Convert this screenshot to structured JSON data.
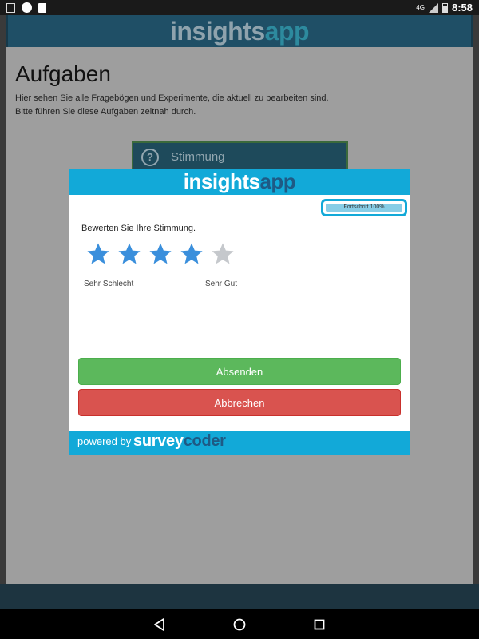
{
  "statusbar": {
    "time": "8:58",
    "network": "4G",
    "icons_left": [
      "notes-icon",
      "circle-icon",
      "sdcard-icon"
    ],
    "icons_right": [
      "signal-icon",
      "battery-icon"
    ]
  },
  "app": {
    "logo_part1": "insights",
    "logo_part2": "app",
    "title": "Aufgaben",
    "description_line1": "Hier sehen Sie alle Fragebögen und Experimente, die aktuell zu bearbeiten sind.",
    "description_line2": "Bitte führen Sie diese Aufgaben zeitnah durch.",
    "task": {
      "label": "Stimmung",
      "icon": "question-icon"
    }
  },
  "modal": {
    "logo_part1": "insights",
    "logo_part2": "app",
    "progress_label": "Fortschritt 100%",
    "progress_fraction": 1.0,
    "question": "Bewerten Sie Ihre Stimmung.",
    "rating": {
      "value": 4,
      "max": 5
    },
    "scale_low": "Sehr Schlecht",
    "scale_high": "Sehr Gut",
    "submit_label": "Absenden",
    "cancel_label": "Abbrechen",
    "footer_powered": "powered by",
    "footer_brand_part1": "survey",
    "footer_brand_part2": "coder"
  },
  "colors": {
    "accent": "#12a9d8",
    "star_filled": "#3a8fdc",
    "star_empty": "#c5c8cc",
    "submit": "#5cb85c",
    "cancel": "#d9534f"
  },
  "navbar": [
    "back-icon",
    "home-icon",
    "recents-icon"
  ]
}
